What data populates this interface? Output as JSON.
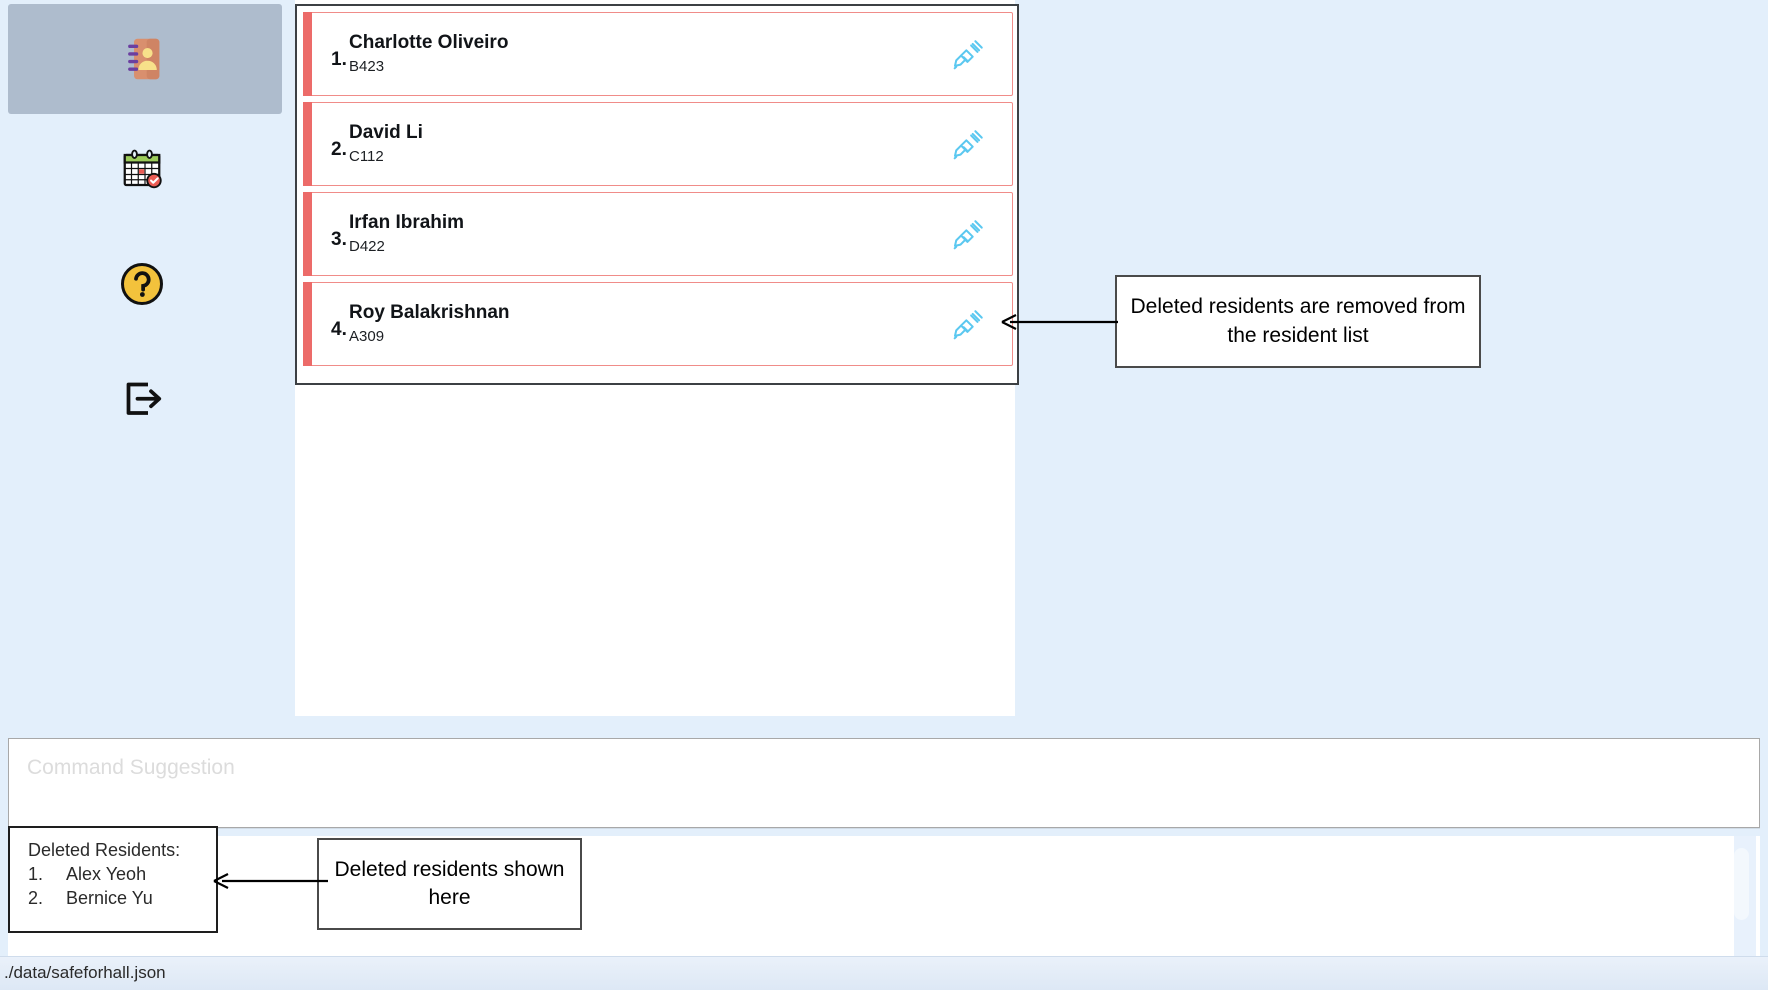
{
  "app": {
    "background_color": "#e3effb",
    "accent_color": "#ec6b69",
    "syringe_color": "#5bc8f0",
    "selected_nav_color": "#aebccd"
  },
  "sidebar": {
    "items": [
      {
        "icon": "address-book-icon",
        "label": "Residents",
        "selected": true
      },
      {
        "icon": "calendar-check-icon",
        "label": "Events",
        "selected": false
      },
      {
        "icon": "help-circle-icon",
        "label": "Help",
        "selected": false
      },
      {
        "icon": "logout-icon",
        "label": "Exit",
        "selected": false
      }
    ]
  },
  "resident_list": {
    "residents": [
      {
        "index": "1.",
        "name": "Charlotte Oliveiro",
        "room": "B423",
        "action_icon": "syringe-icon"
      },
      {
        "index": "2.",
        "name": "David Li",
        "room": "C112",
        "action_icon": "syringe-icon"
      },
      {
        "index": "3.",
        "name": "Irfan Ibrahim",
        "room": "D422",
        "action_icon": "syringe-icon"
      },
      {
        "index": "4.",
        "name": "Roy Balakrishnan",
        "room": "A309",
        "action_icon": "syringe-icon"
      }
    ]
  },
  "command": {
    "placeholder": "Command Suggestion",
    "value": ""
  },
  "result": {
    "value": ""
  },
  "deleted_panel": {
    "title": "Deleted Residents:",
    "items": [
      {
        "num": "1.",
        "name": "Alex Yeoh"
      },
      {
        "num": "2.",
        "name": "Bernice Yu"
      }
    ]
  },
  "annotations": {
    "removed_from_list": "Deleted residents are removed from the resident list",
    "shown_here": "Deleted residents shown here"
  },
  "status_bar": {
    "file_path": "./data/safeforhall.json"
  }
}
